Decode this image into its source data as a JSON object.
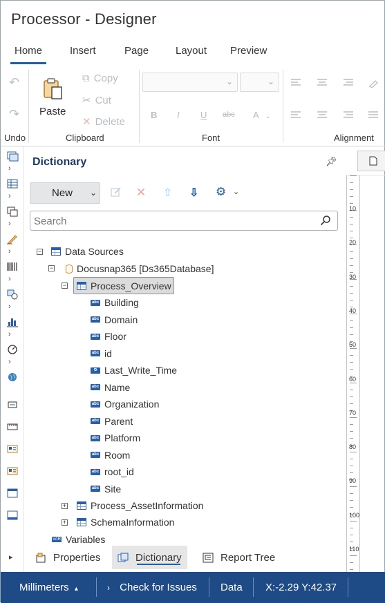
{
  "window": {
    "title": "Processor - Designer"
  },
  "ribbon_tabs": [
    "Home",
    "Insert",
    "Page",
    "Layout",
    "Preview"
  ],
  "ribbon": {
    "undo_label": "Undo",
    "clipboard": {
      "paste": "Paste",
      "copy": "Copy",
      "cut": "Cut",
      "delete": "Delete",
      "label": "Clipboard"
    },
    "font": {
      "label": "Font",
      "bold": "B",
      "italic": "I",
      "underline": "U",
      "strikethrough": "abc",
      "color": "A"
    },
    "alignment": {
      "label": "Alignment"
    }
  },
  "dictionary": {
    "title": "Dictionary",
    "new_button": "New",
    "search_placeholder": "Search",
    "tree": {
      "data_sources": "Data Sources",
      "connection": "Docusnap365 [Ds365Database]",
      "selected_table": "Process_Overview",
      "fields": [
        "Building",
        "Domain",
        "Floor",
        "id",
        "Last_Write_Time",
        "Name",
        "Organization",
        "Parent",
        "Platform",
        "Room",
        "root_id",
        "Site"
      ],
      "other_tables": [
        "Process_AssetInformation",
        "SchemaInformation"
      ],
      "variables": "Variables"
    }
  },
  "bottom_tabs": [
    "Properties",
    "Dictionary",
    "Report Tree"
  ],
  "ruler": {
    "labels": [
      "10",
      "20",
      "30",
      "40",
      "50",
      "60",
      "70",
      "80",
      "90",
      "100",
      "110"
    ]
  },
  "status_bar": {
    "units": "Millimeters",
    "check": "Check for Issues",
    "data": "Data",
    "coords": "X:-2.29 Y:42.37"
  },
  "colors": {
    "accent": "#1f5fa6",
    "status_bg": "#1e4a85",
    "panel_title": "#1e3a62",
    "delete_red": "#e36b6b"
  }
}
